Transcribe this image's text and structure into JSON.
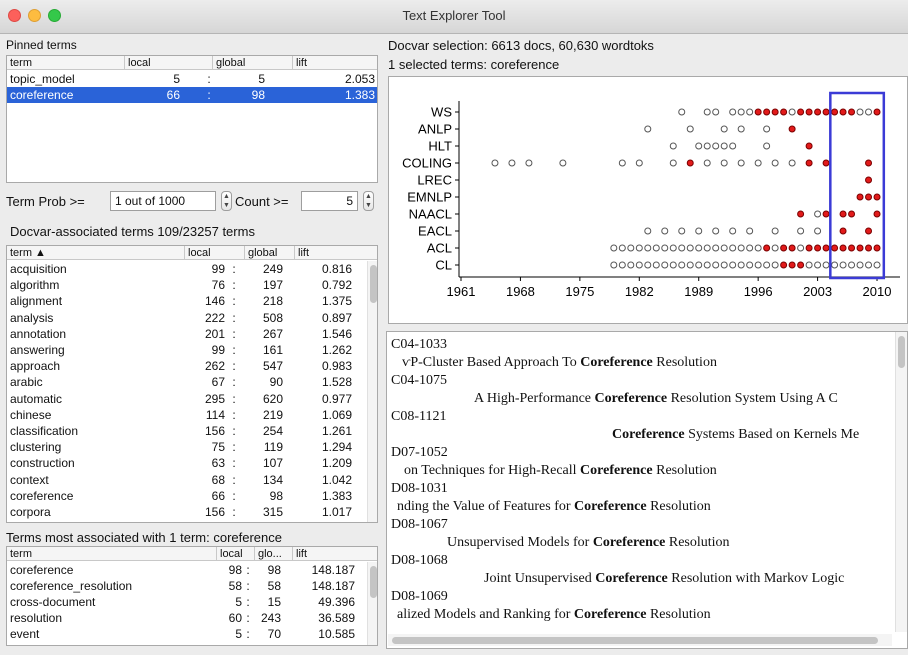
{
  "window": {
    "title": "Text Explorer Tool"
  },
  "pinned": {
    "label": "Pinned terms",
    "columns": [
      "term",
      "local",
      "global",
      "lift"
    ],
    "rows": [
      {
        "term": "topic_model",
        "local": "5",
        "global": "5",
        "lift": "2.053",
        "selected": false
      },
      {
        "term": "coreference",
        "local": "66",
        "global": "98",
        "lift": "1.383",
        "selected": true
      }
    ]
  },
  "filter": {
    "prob_label": "Term Prob >=",
    "prob_value": "1 out of 1000",
    "count_label": "Count >=",
    "count_value": "5"
  },
  "docvar_terms": {
    "label": "Docvar-associated terms 109/23257 terms",
    "columns": [
      "term ▲",
      "local",
      "global",
      "lift"
    ],
    "rows": [
      [
        "acquisition",
        "99",
        "249",
        "0.816"
      ],
      [
        "algorithm",
        "76",
        "197",
        "0.792"
      ],
      [
        "alignment",
        "146",
        "218",
        "1.375"
      ],
      [
        "analysis",
        "222",
        "508",
        "0.897"
      ],
      [
        "annotation",
        "201",
        "267",
        "1.546"
      ],
      [
        "answering",
        "99",
        "161",
        "1.262"
      ],
      [
        "approach",
        "262",
        "547",
        "0.983"
      ],
      [
        "arabic",
        "67",
        "90",
        "1.528"
      ],
      [
        "automatic",
        "295",
        "620",
        "0.977"
      ],
      [
        "chinese",
        "114",
        "219",
        "1.069"
      ],
      [
        "classification",
        "156",
        "254",
        "1.261"
      ],
      [
        "clustering",
        "75",
        "119",
        "1.294"
      ],
      [
        "construction",
        "63",
        "107",
        "1.209"
      ],
      [
        "context",
        "68",
        "134",
        "1.042"
      ],
      [
        "coreference",
        "66",
        "98",
        "1.383"
      ],
      [
        "corpora",
        "156",
        "315",
        "1.017"
      ]
    ]
  },
  "term_assoc": {
    "label": "Terms most associated with 1 term: coreference",
    "columns": [
      "term",
      "local",
      "glo...",
      "lift"
    ],
    "rows": [
      [
        "coreference",
        "98",
        "98",
        "148.187"
      ],
      [
        "coreference_resolution",
        "58",
        "58",
        "148.187"
      ],
      [
        "cross-document",
        "5",
        "15",
        "49.396"
      ],
      [
        "resolution",
        "60",
        "243",
        "36.589"
      ],
      [
        "event",
        "5",
        "70",
        "10.585"
      ]
    ]
  },
  "selection": {
    "docvar_line": "Docvar selection: 6613 docs, 60,630 wordtoks",
    "terms_line": "1 selected terms: coreference"
  },
  "chart_data": {
    "type": "scatter",
    "title": "",
    "xlabel": "",
    "ylabel": "",
    "categories": [
      "WS",
      "ANLP",
      "HLT",
      "COLING",
      "LREC",
      "EMNLP",
      "NAACL",
      "EACL",
      "ACL",
      "CL"
    ],
    "xlim": [
      1961,
      2012
    ],
    "xticks": [
      1961,
      1968,
      1975,
      1982,
      1989,
      1996,
      2003,
      2010
    ],
    "selection_range": [
      2004.5,
      2010.8
    ],
    "legend": "none",
    "colors": {
      "hit": "#e21a1a",
      "no_hit": "#ffffff",
      "selected_box": "#3b3bd6"
    },
    "points": {
      "WS": {
        "x": [
          1987,
          1990,
          1991,
          1993,
          1994,
          1995,
          1996,
          1997,
          1998,
          1999,
          2000,
          2001,
          2002,
          2003,
          2004,
          2005,
          2006,
          2007,
          2008,
          2009,
          2010
        ],
        "hit": [
          0,
          0,
          0,
          0,
          0,
          0,
          1,
          1,
          1,
          1,
          0,
          1,
          1,
          1,
          1,
          1,
          1,
          1,
          0,
          0,
          1
        ]
      },
      "ANLP": {
        "x": [
          1983,
          1988,
          1992,
          1994,
          1997,
          2000
        ],
        "hit": [
          0,
          0,
          0,
          0,
          0,
          1
        ]
      },
      "HLT": {
        "x": [
          1986,
          1989,
          1990,
          1991,
          1992,
          1993,
          1997,
          2002
        ],
        "hit": [
          0,
          0,
          0,
          0,
          0,
          0,
          0,
          1
        ]
      },
      "COLING": {
        "x": [
          1965,
          1967,
          1969,
          1973,
          1980,
          1982,
          1986,
          1988,
          1990,
          1992,
          1994,
          1996,
          1998,
          2000,
          2002,
          2004,
          2009
        ],
        "hit": [
          0,
          0,
          0,
          0,
          0,
          0,
          0,
          1,
          0,
          0,
          0,
          0,
          0,
          0,
          1,
          1,
          1
        ]
      },
      "LREC": {
        "x": [
          2009
        ],
        "hit": [
          1
        ]
      },
      "EMNLP": {
        "x": [
          2008,
          2009,
          2010
        ],
        "hit": [
          1,
          1,
          1
        ]
      },
      "NAACL": {
        "x": [
          2001,
          2003,
          2004,
          2006,
          2007,
          2010
        ],
        "hit": [
          1,
          0,
          1,
          1,
          1,
          1
        ]
      },
      "EACL": {
        "x": [
          1983,
          1985,
          1987,
          1989,
          1991,
          1993,
          1995,
          1998,
          2001,
          2003,
          2006,
          2009
        ],
        "hit": [
          0,
          0,
          0,
          0,
          0,
          0,
          0,
          0,
          0,
          0,
          1,
          1
        ]
      },
      "ACL": {
        "x": [
          1979,
          1980,
          1981,
          1982,
          1983,
          1984,
          1985,
          1986,
          1987,
          1988,
          1989,
          1990,
          1991,
          1992,
          1993,
          1994,
          1995,
          1996,
          1997,
          1998,
          1999,
          2000,
          2001,
          2002,
          2003,
          2004,
          2005,
          2006,
          2007,
          2008,
          2009,
          2010
        ],
        "hit": [
          0,
          0,
          0,
          0,
          0,
          0,
          0,
          0,
          0,
          0,
          0,
          0,
          0,
          0,
          0,
          0,
          0,
          0,
          1,
          0,
          1,
          1,
          0,
          1,
          1,
          1,
          1,
          1,
          1,
          1,
          1,
          1
        ]
      },
      "CL": {
        "x": [
          1979,
          1980,
          1981,
          1982,
          1983,
          1984,
          1985,
          1986,
          1987,
          1988,
          1989,
          1990,
          1991,
          1992,
          1993,
          1994,
          1995,
          1996,
          1997,
          1998,
          1999,
          2000,
          2001,
          2002,
          2003,
          2004,
          2005,
          2006,
          2007,
          2008,
          2009,
          2010
        ],
        "hit": [
          0,
          0,
          0,
          0,
          0,
          0,
          0,
          0,
          0,
          0,
          0,
          0,
          0,
          0,
          0,
          0,
          0,
          0,
          0,
          0,
          1,
          1,
          1,
          0,
          0,
          0,
          0,
          0,
          0,
          0,
          0,
          0
        ]
      }
    }
  },
  "documents": [
    {
      "id": "C04-1033",
      "pre": "ⱱP-Cluster Based Approach To ",
      "bold": "Coreference",
      "post": " Resolution",
      "indent": 15
    },
    {
      "id": "C04-1075",
      "pre": "A High-Performance ",
      "bold": "Coreference",
      "post": " Resolution System Using A C",
      "indent": 87
    },
    {
      "id": "C08-1121",
      "pre": "",
      "bold": "Coreference",
      "post": " Systems Based on Kernels Me",
      "indent": 225
    },
    {
      "id": "D07-1052",
      "pre": "on Techniques for High-Recall ",
      "bold": "Coreference",
      "post": " Resolution",
      "indent": 17
    },
    {
      "id": "D08-1031",
      "pre": "nding the Value of Features for ",
      "bold": "Coreference",
      "post": " Resolution",
      "indent": 10
    },
    {
      "id": "D08-1067",
      "pre": "Unsupervised Models for ",
      "bold": "Coreference",
      "post": " Resolution",
      "indent": 60
    },
    {
      "id": "D08-1068",
      "pre": "Joint Unsupervised ",
      "bold": "Coreference",
      "post": " Resolution with Markov Logic",
      "indent": 97
    },
    {
      "id": "D08-1069",
      "pre": "alized Models and Ranking for ",
      "bold": "Coreference",
      "post": " Resolution",
      "indent": 10
    }
  ]
}
